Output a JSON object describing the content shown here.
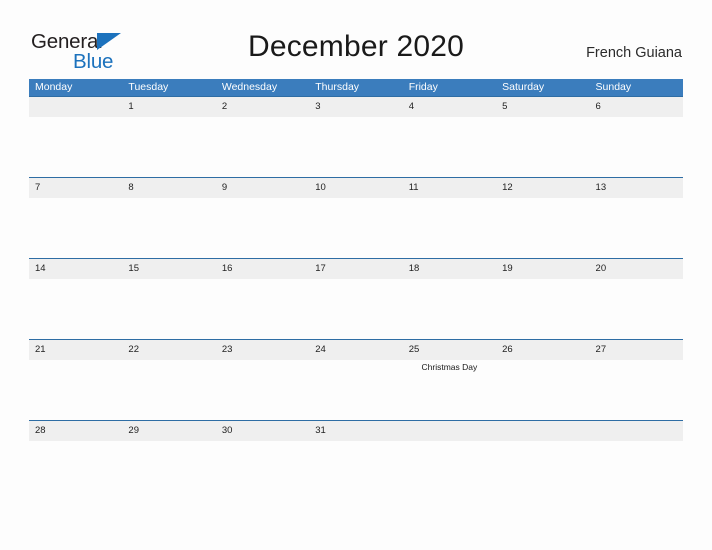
{
  "brand": {
    "name_part1": "General",
    "name_part2": "Blue",
    "triangle_color": "#1c72bd"
  },
  "header": {
    "title": "December 2020",
    "locale": "French Guiana"
  },
  "calendar": {
    "header_color": "#3b7dbd",
    "rule_color": "#2e6da4",
    "band_color": "#efefef",
    "weekdays": [
      "Monday",
      "Tuesday",
      "Wednesday",
      "Thursday",
      "Friday",
      "Saturday",
      "Sunday"
    ],
    "weeks": [
      {
        "days": [
          "",
          "1",
          "2",
          "3",
          "4",
          "5",
          "6"
        ],
        "events": [
          "",
          "",
          "",
          "",
          "",
          "",
          ""
        ]
      },
      {
        "days": [
          "7",
          "8",
          "9",
          "10",
          "11",
          "12",
          "13"
        ],
        "events": [
          "",
          "",
          "",
          "",
          "",
          "",
          ""
        ]
      },
      {
        "days": [
          "14",
          "15",
          "16",
          "17",
          "18",
          "19",
          "20"
        ],
        "events": [
          "",
          "",
          "",
          "",
          "",
          "",
          ""
        ]
      },
      {
        "days": [
          "21",
          "22",
          "23",
          "24",
          "25",
          "26",
          "27"
        ],
        "events": [
          "",
          "",
          "",
          "",
          "Christmas Day",
          "",
          ""
        ]
      },
      {
        "days": [
          "28",
          "29",
          "30",
          "31",
          "",
          "",
          ""
        ],
        "events": [
          "",
          "",
          "",
          "",
          "",
          "",
          ""
        ]
      }
    ]
  }
}
